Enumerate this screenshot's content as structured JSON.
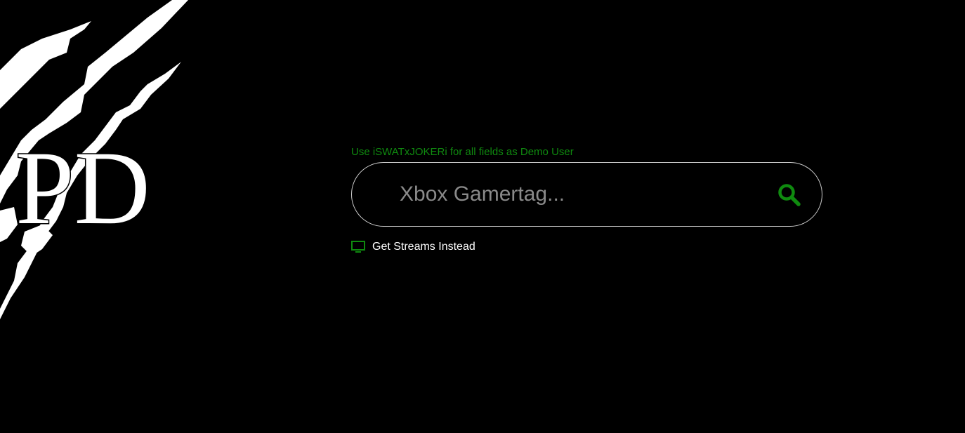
{
  "logo": {
    "text": "PD"
  },
  "search": {
    "hint": "Use iSWATxJOKERi for all fields as Demo User",
    "placeholder": "Xbox Gamertag...",
    "value": ""
  },
  "streams_link": {
    "label": "Get Streams Instead",
    "icon": "monitor-icon"
  },
  "colors": {
    "background": "#000000",
    "accent": "#0f8a0f",
    "border": "#cfcfcf",
    "placeholder": "#8a8a8a",
    "text": "#ffffff"
  }
}
